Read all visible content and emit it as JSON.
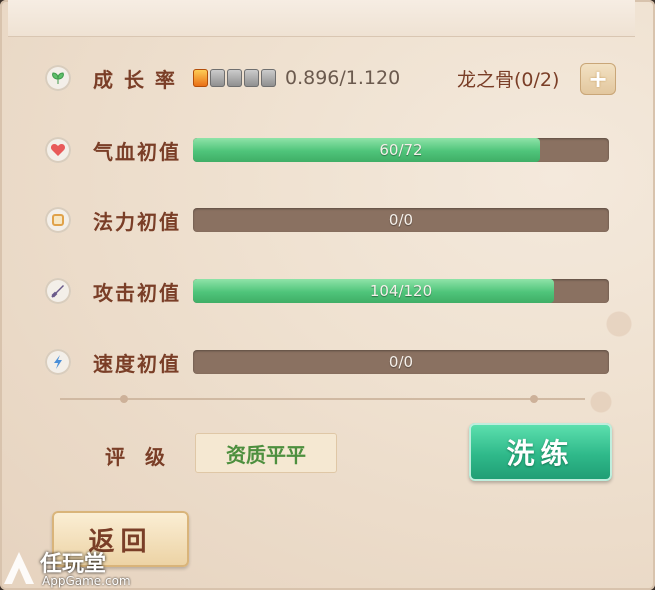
{
  "growth": {
    "label": "成 长 率",
    "value": "0.896/1.120",
    "gems_on": 1,
    "gems_total": 5
  },
  "dragon_bone": {
    "label": "龙之骨(0/2)",
    "plus": "+"
  },
  "stats": [
    {
      "label": "气血初值",
      "text": "60/72",
      "fraction": 0.8333,
      "icon": "heart-icon"
    },
    {
      "label": "法力初值",
      "text": "0/0",
      "fraction": 0,
      "icon": "mana-icon"
    },
    {
      "label": "攻击初值",
      "text": "104/120",
      "fraction": 0.8667,
      "icon": "sword-icon"
    },
    {
      "label": "速度初值",
      "text": "0/0",
      "fraction": 0,
      "icon": "lightning-icon"
    }
  ],
  "rating": {
    "label": "评　级",
    "value": "资质平平"
  },
  "buttons": {
    "refine": "洗练",
    "back": "返回"
  },
  "watermark": {
    "brand": "任玩堂",
    "site": "AppGame.com"
  },
  "colors": {
    "bar_fill": "#4fc47a",
    "bar_track": "#8a7161",
    "label": "#7a3e27",
    "refine_button": "#2fb98a"
  }
}
